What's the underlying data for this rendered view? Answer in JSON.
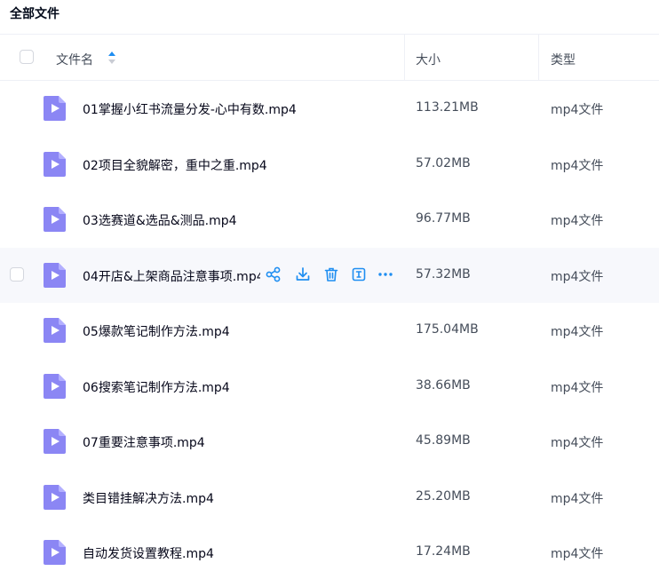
{
  "header": {
    "title": "全部文件",
    "col_name": "文件名",
    "col_size": "大小",
    "col_type": "类型"
  },
  "colors": {
    "accent": "#1f8ef1",
    "icon_purple": "#8b86f4",
    "hover_bg": "#f7f8fc"
  },
  "files": [
    {
      "name": "01掌握小红书流量分发-心中有数.mp4",
      "size": "113.21MB",
      "type": "mp4文件",
      "icon": "video-file-icon"
    },
    {
      "name": "02项目全貌解密，重中之重.mp4",
      "size": "57.02MB",
      "type": "mp4文件",
      "icon": "video-file-icon"
    },
    {
      "name": "03选赛道&选品&测品.mp4",
      "size": "96.77MB",
      "type": "mp4文件",
      "icon": "video-file-icon"
    },
    {
      "name": "04开店&上架商品注意事项.mp4",
      "size": "57.32MB",
      "type": "mp4文件",
      "icon": "video-file-icon",
      "hovered": true
    },
    {
      "name": "05爆款笔记制作方法.mp4",
      "size": "175.04MB",
      "type": "mp4文件",
      "icon": "video-file-icon"
    },
    {
      "name": "06搜索笔记制作方法.mp4",
      "size": "38.66MB",
      "type": "mp4文件",
      "icon": "video-file-icon"
    },
    {
      "name": "07重要注意事项.mp4",
      "size": "45.89MB",
      "type": "mp4文件",
      "icon": "video-file-icon"
    },
    {
      "name": "类目错挂解决方法.mp4",
      "size": "25.20MB",
      "type": "mp4文件",
      "icon": "video-file-icon"
    },
    {
      "name": "自动发货设置教程.mp4",
      "size": "17.24MB",
      "type": "mp4文件",
      "icon": "video-file-icon"
    }
  ],
  "row_actions": [
    "share-icon",
    "download-icon",
    "delete-icon",
    "rename-icon",
    "more-icon"
  ]
}
